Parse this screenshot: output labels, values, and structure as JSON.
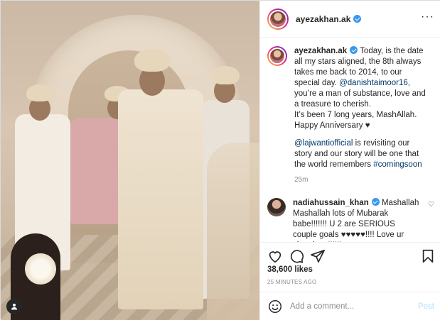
{
  "post": {
    "username": "ayezakhan.ak",
    "verified": true,
    "more_icon": "more-horizontal-icon"
  },
  "caption": {
    "username": "ayezakhan.ak",
    "lines": [
      "Today, is the date all my stars aligned, the 8th always takes me back to 2014, to our special day.",
      "@danishtaimoor16",
      ", you’re a man of substance, love and a treasure to cherish.",
      "It’s been 7 long years, MashAllah.",
      "Happy Anniversary ♥",
      "@lajwantiofficial",
      " is revisiting our story and our story will be one that the world remembers ",
      "#comingsoon"
    ],
    "time": "25m"
  },
  "comment": {
    "username": "nadiahussain_khan",
    "text": "Mashallah Mashallah lots of Mubarak babe!!!!!!! U 2 are SERIOUS couple goals ♥♥♥♥♥!!!! Love ur chemistry!!!!!!"
  },
  "likes": "38,600 likes",
  "posted_ago": "25 MINUTES AGO",
  "add_comment": {
    "placeholder": "Add a comment...",
    "post_label": "Post"
  },
  "colors": {
    "link": "#00376b",
    "verified": "#3897f0",
    "post_button": "#b2dffc"
  }
}
